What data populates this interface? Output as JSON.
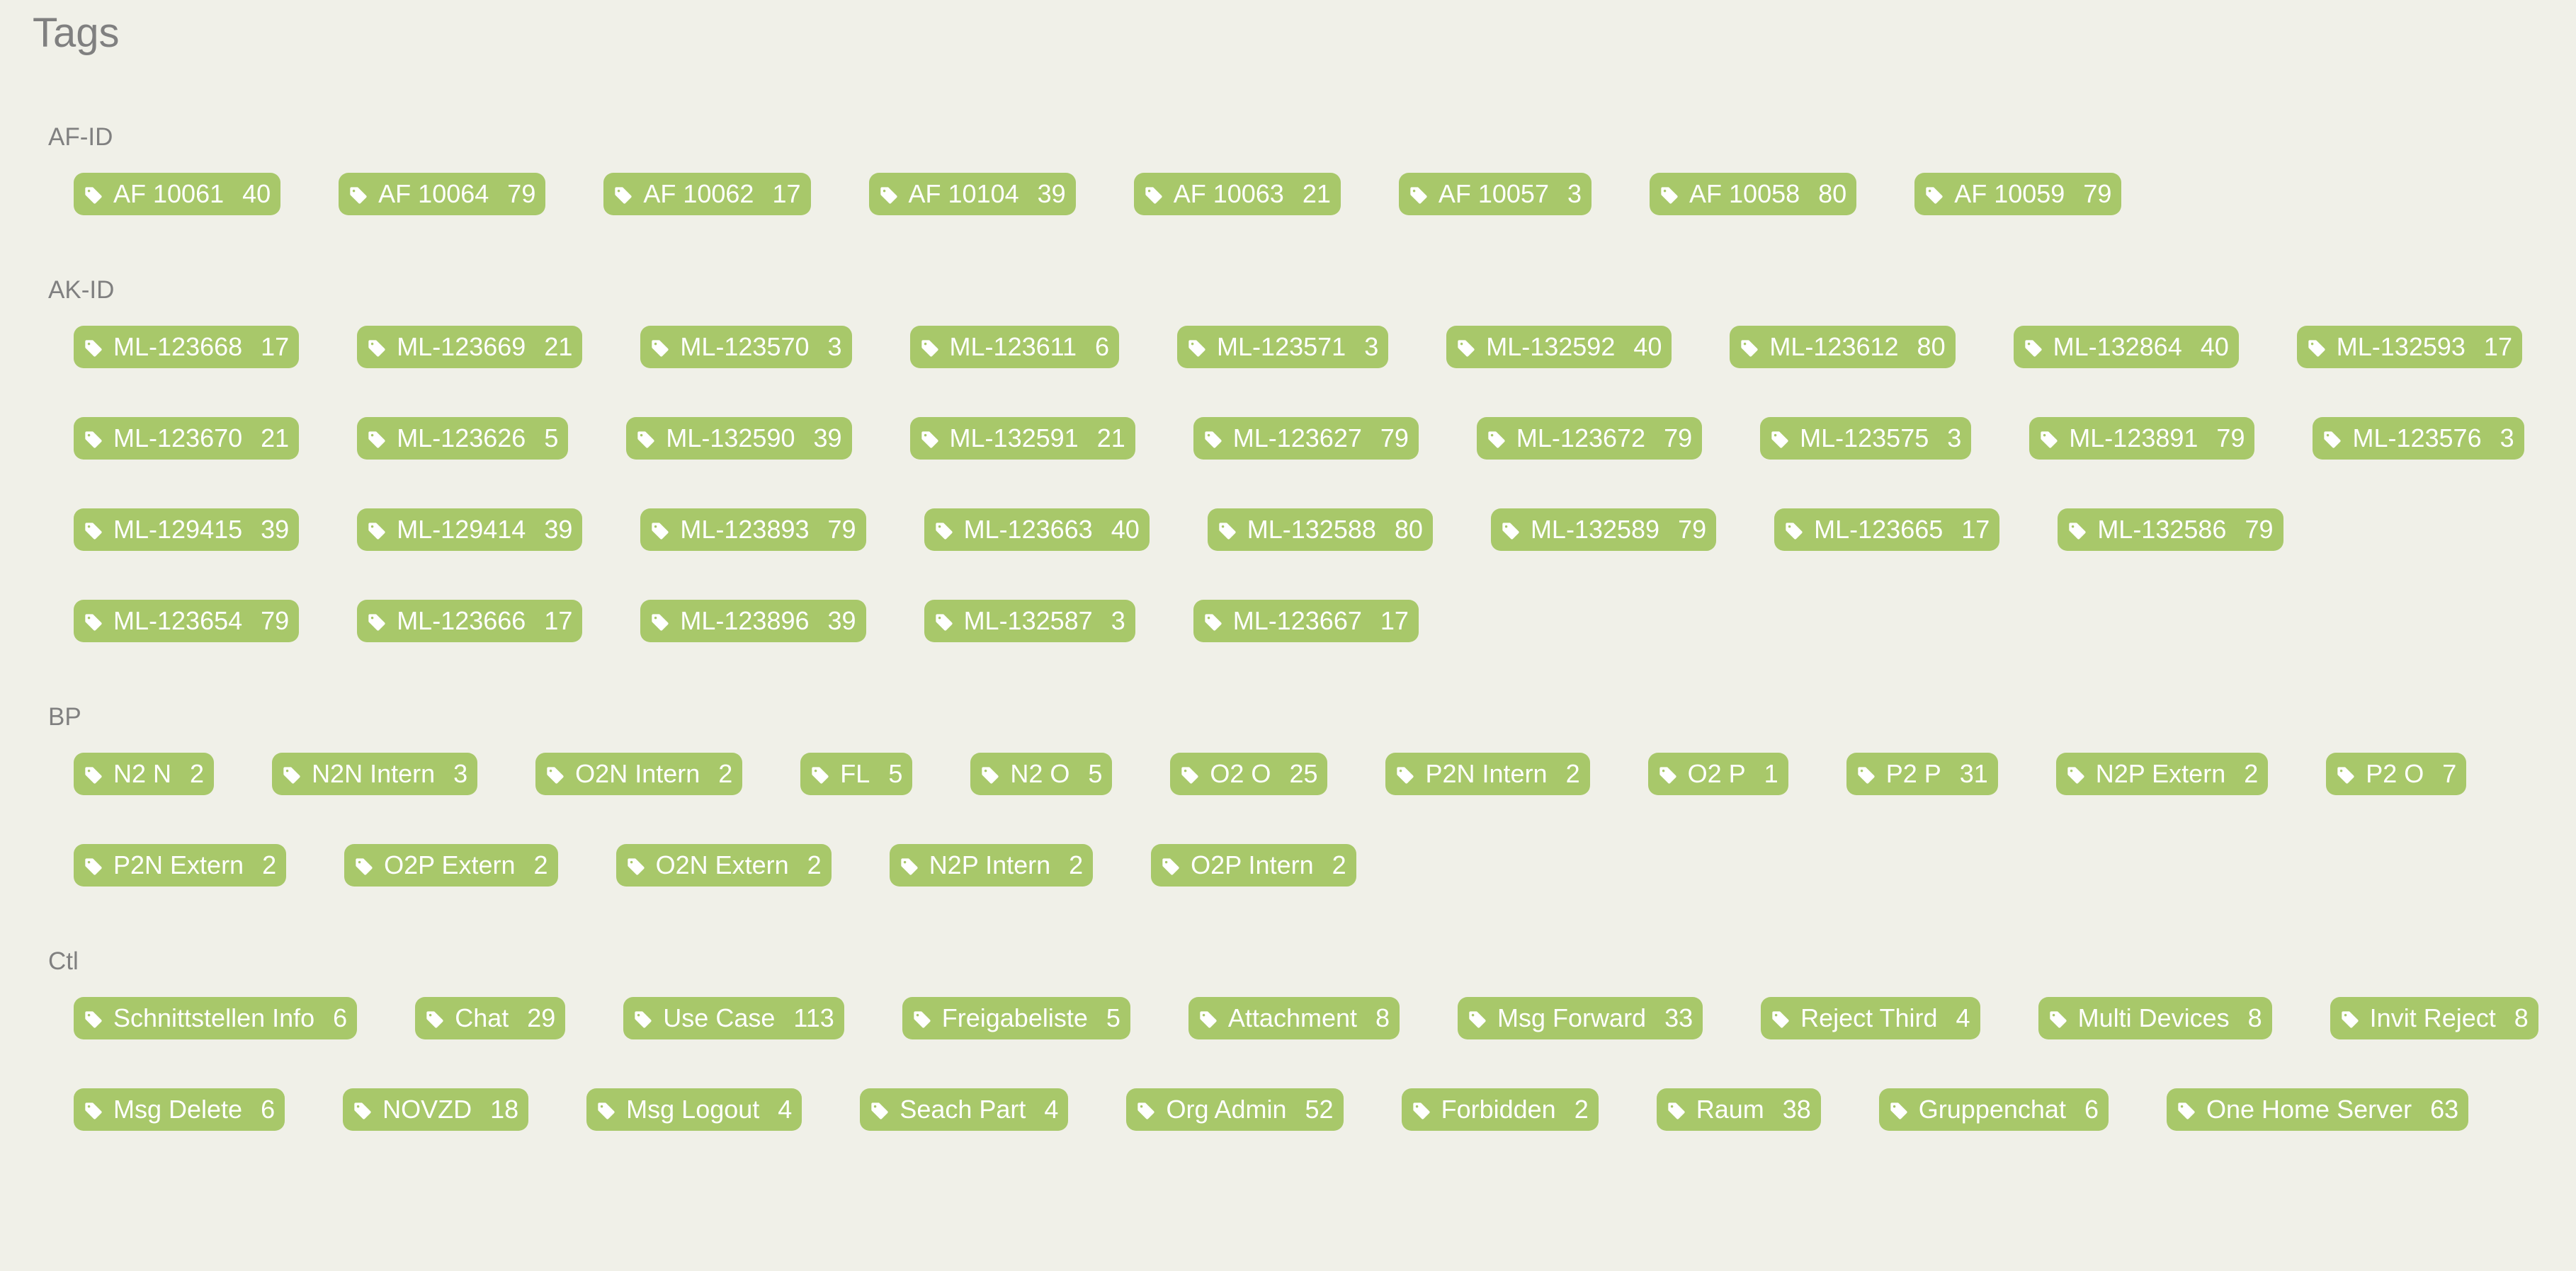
{
  "page": {
    "title": "Tags"
  },
  "colors": {
    "background": "#f0f0e8",
    "tag_bg": "#a8c86a",
    "tag_text": "#ffffff",
    "heading": "#808080"
  },
  "icons": {
    "tag": "tag-icon"
  },
  "sections": [
    {
      "title": "AF-ID",
      "tags": [
        {
          "name": "AF 10061",
          "count": "40"
        },
        {
          "name": "AF 10064",
          "count": "79"
        },
        {
          "name": "AF 10062",
          "count": "17"
        },
        {
          "name": "AF 10104",
          "count": "39"
        },
        {
          "name": "AF 10063",
          "count": "21"
        },
        {
          "name": "AF 10057",
          "count": "3"
        },
        {
          "name": "AF 10058",
          "count": "80"
        },
        {
          "name": "AF 10059",
          "count": "79"
        }
      ]
    },
    {
      "title": "AK-ID",
      "tags": [
        {
          "name": "ML-123668",
          "count": "17"
        },
        {
          "name": "ML-123669",
          "count": "21"
        },
        {
          "name": "ML-123570",
          "count": "3"
        },
        {
          "name": "ML-123611",
          "count": "6"
        },
        {
          "name": "ML-123571",
          "count": "3"
        },
        {
          "name": "ML-132592",
          "count": "40"
        },
        {
          "name": "ML-123612",
          "count": "80"
        },
        {
          "name": "ML-132864",
          "count": "40"
        },
        {
          "name": "ML-132593",
          "count": "17"
        },
        {
          "name": "ML-123670",
          "count": "21"
        },
        {
          "name": "ML-123626",
          "count": "5"
        },
        {
          "name": "ML-132590",
          "count": "39"
        },
        {
          "name": "ML-132591",
          "count": "21"
        },
        {
          "name": "ML-123627",
          "count": "79"
        },
        {
          "name": "ML-123672",
          "count": "79"
        },
        {
          "name": "ML-123575",
          "count": "3"
        },
        {
          "name": "ML-123891",
          "count": "79"
        },
        {
          "name": "ML-123576",
          "count": "3"
        },
        {
          "name": "ML-129415",
          "count": "39"
        },
        {
          "name": "ML-129414",
          "count": "39"
        },
        {
          "name": "ML-123893",
          "count": "79"
        },
        {
          "name": "ML-123663",
          "count": "40"
        },
        {
          "name": "ML-132588",
          "count": "80"
        },
        {
          "name": "ML-132589",
          "count": "79"
        },
        {
          "name": "ML-123665",
          "count": "17"
        },
        {
          "name": "ML-132586",
          "count": "79"
        },
        {
          "name": "ML-123654",
          "count": "79"
        },
        {
          "name": "ML-123666",
          "count": "17"
        },
        {
          "name": "ML-123896",
          "count": "39"
        },
        {
          "name": "ML-132587",
          "count": "3"
        },
        {
          "name": "ML-123667",
          "count": "17"
        }
      ]
    },
    {
      "title": "BP",
      "tags": [
        {
          "name": "N2 N",
          "count": "2"
        },
        {
          "name": "N2N Intern",
          "count": "3"
        },
        {
          "name": "O2N Intern",
          "count": "2"
        },
        {
          "name": "FL",
          "count": "5"
        },
        {
          "name": "N2 O",
          "count": "5"
        },
        {
          "name": "O2 O",
          "count": "25"
        },
        {
          "name": "P2N Intern",
          "count": "2"
        },
        {
          "name": "O2 P",
          "count": "1"
        },
        {
          "name": "P2 P",
          "count": "31"
        },
        {
          "name": "N2P Extern",
          "count": "2"
        },
        {
          "name": "P2 O",
          "count": "7"
        },
        {
          "name": "P2N Extern",
          "count": "2"
        },
        {
          "name": "O2P Extern",
          "count": "2"
        },
        {
          "name": "O2N Extern",
          "count": "2"
        },
        {
          "name": "N2P Intern",
          "count": "2"
        },
        {
          "name": "O2P Intern",
          "count": "2"
        }
      ]
    },
    {
      "title": "Ctl",
      "tags": [
        {
          "name": "Schnittstellen Info",
          "count": "6"
        },
        {
          "name": "Chat",
          "count": "29"
        },
        {
          "name": "Use Case",
          "count": "113"
        },
        {
          "name": "Freigabeliste",
          "count": "5"
        },
        {
          "name": "Attachment",
          "count": "8"
        },
        {
          "name": "Msg Forward",
          "count": "33"
        },
        {
          "name": "Reject Third",
          "count": "4"
        },
        {
          "name": "Multi Devices",
          "count": "8"
        },
        {
          "name": "Invit Reject",
          "count": "8"
        },
        {
          "name": "Msg Delete",
          "count": "6"
        },
        {
          "name": "NOVZD",
          "count": "18"
        },
        {
          "name": "Msg Logout",
          "count": "4"
        },
        {
          "name": "Seach Part",
          "count": "4"
        },
        {
          "name": "Org Admin",
          "count": "52"
        },
        {
          "name": "Forbidden",
          "count": "2"
        },
        {
          "name": "Raum",
          "count": "38"
        },
        {
          "name": "Gruppenchat",
          "count": "6"
        },
        {
          "name": "One Home Server",
          "count": "63"
        }
      ]
    }
  ]
}
